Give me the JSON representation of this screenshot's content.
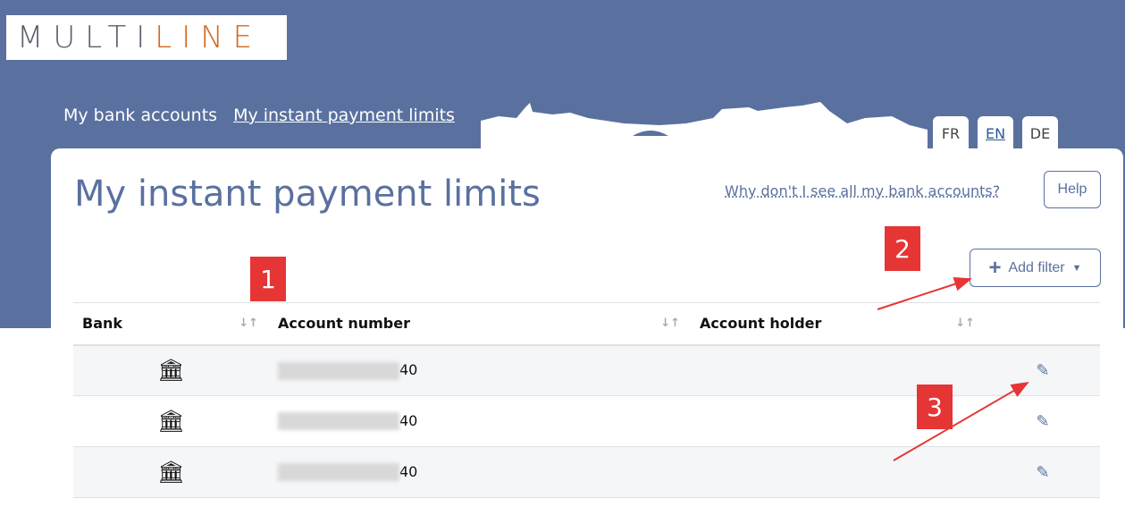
{
  "logo": {
    "part1": "MULTI",
    "part2": "LINE"
  },
  "nav": [
    {
      "label": "My bank accounts",
      "active": false
    },
    {
      "label": "My instant payment limits",
      "active": true
    }
  ],
  "languages": [
    {
      "code": "FR",
      "active": false
    },
    {
      "code": "EN",
      "active": true
    },
    {
      "code": "DE",
      "active": false
    }
  ],
  "page": {
    "title": "My instant payment limits",
    "why_link": "Why don't I see all my bank accounts?",
    "help_label": "Help",
    "filter_label": "Add filter"
  },
  "table": {
    "columns": [
      "Bank",
      "Account number",
      "Account holder"
    ],
    "rows": [
      {
        "account_suffix": "40",
        "holder": ""
      },
      {
        "account_suffix": "40",
        "holder": ""
      },
      {
        "account_suffix": "40",
        "holder": ""
      }
    ]
  },
  "annotations": {
    "badge1": "1",
    "badge2": "2",
    "badge3": "3"
  },
  "colors": {
    "header": "#5a719f",
    "accent": "#d2691e",
    "badge": "#e63535"
  }
}
